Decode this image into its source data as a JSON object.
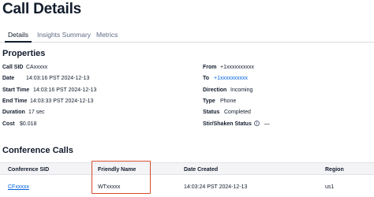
{
  "page": {
    "title": "Call Details"
  },
  "tabs": [
    {
      "label": "Details",
      "active": true
    },
    {
      "label": "Insights Summary",
      "active": false
    },
    {
      "label": "Metrics",
      "active": false
    }
  ],
  "properties": {
    "title": "Properties",
    "left": [
      {
        "key": "Call SID",
        "value": "CAxxxxx"
      },
      {
        "key": "Date",
        "value": "14:03:16 PST 2024-12-13"
      },
      {
        "key": "Start Time",
        "value": "14:03:16 PST 2024-12-13"
      },
      {
        "key": "End Time",
        "value": "14:03:33 PST 2024-12-13"
      },
      {
        "key": "Duration",
        "value": "17 sec"
      },
      {
        "key": "Cost",
        "value": "$0.018"
      }
    ],
    "right": [
      {
        "key": "From",
        "value": "+1xxxxxxxxxx"
      },
      {
        "key": "To",
        "value": "+1xxxxxxxxxx"
      },
      {
        "key": "Direction",
        "value": "Incoming"
      },
      {
        "key": "Type",
        "value": "Phone"
      },
      {
        "key": "Status",
        "value": "Completed"
      },
      {
        "key": "Stir/Shaken Status",
        "value": "—"
      }
    ]
  },
  "conference": {
    "title": "Conference Calls",
    "columns": [
      "Conference SID",
      "Friendly Name",
      "Date Created",
      "Region"
    ],
    "rows": [
      [
        "CFxxxxx",
        "WTxxxxx",
        "14:03:24 PST 2024-12-13",
        "us1"
      ]
    ]
  },
  "colors": {
    "link": "#0263e0",
    "highlight": "#d64a2c",
    "text": "#121c2d"
  },
  "icons": {
    "stir_shaken_info": "info-circle-icon"
  }
}
